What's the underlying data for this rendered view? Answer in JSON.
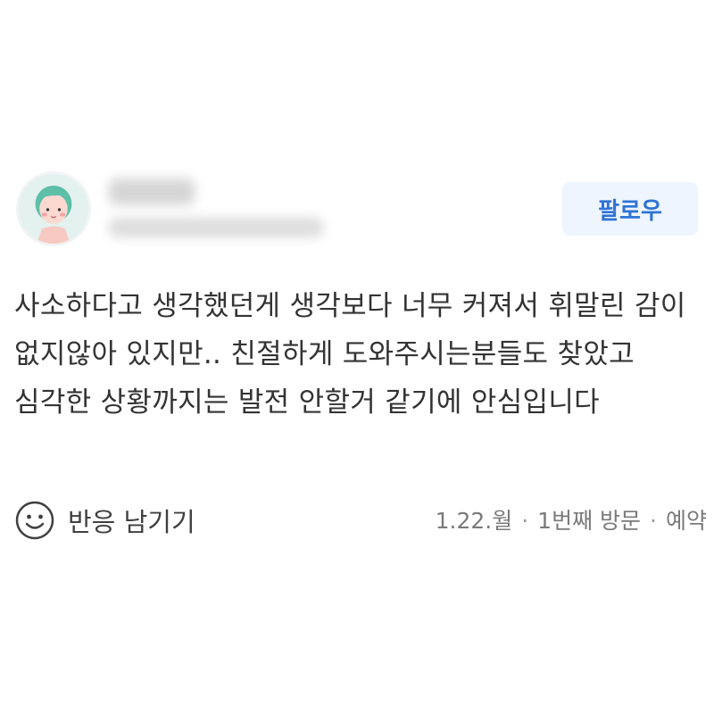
{
  "follow_button": {
    "label": "팔로우"
  },
  "review": {
    "text": "사소하다고 생각했던게 생각보다 너무 커져서 휘말린 감이 없지않아 있지만.. 친절하게 도와주시는분들도 찾았고 심각한 상황까지는 발전 안할거 같기에 안심입니다"
  },
  "footer": {
    "reaction_label": "반응 남기기",
    "date": "1.22.월",
    "visit_count": "1번째 방문",
    "visit_type": "예약",
    "separator": "·"
  },
  "icons": {
    "reaction": "smile-icon",
    "avatar": "avatar-illustration"
  },
  "colors": {
    "accent": "#2f73d4",
    "follow_bg": "#eef5fe",
    "avatar_bg": "#e3f1ef",
    "text": "#333333",
    "meta_text": "#7a7a7a"
  }
}
